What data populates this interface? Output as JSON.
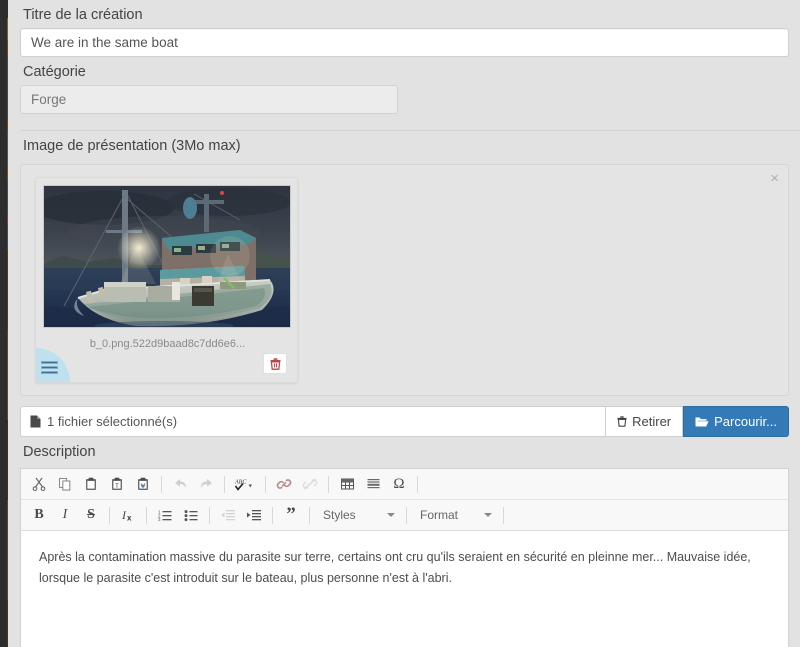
{
  "form": {
    "title_label": "Titre de la création",
    "title_value": "We are in the same boat",
    "category_label": "Catégorie",
    "category_value": "Forge",
    "image_label": "Image de présentation (3Mo max)",
    "description_label": "Description"
  },
  "dropzone": {
    "close_icon": "×",
    "thumbnail": {
      "filename": "b_0.png.522d9baad8c7dd6e6...",
      "alt": "fishing-trawler-at-night",
      "trash_icon": "trash-icon",
      "handle_icon": "drag-handle-icon"
    }
  },
  "file_row": {
    "file_icon": "file-icon",
    "status_text": "1 fichier sélectionné(s)",
    "remove_label": "Retirer",
    "remove_icon": "trash-icon",
    "browse_label": "Parcourir...",
    "browse_icon": "folder-open-icon"
  },
  "editor": {
    "toolbar_row1": [
      {
        "name": "cut-icon",
        "title": "Couper",
        "disabled": false
      },
      {
        "name": "copy-icon",
        "title": "Copier",
        "disabled": false
      },
      {
        "name": "paste-icon",
        "title": "Coller",
        "disabled": false
      },
      {
        "name": "paste-text-icon",
        "title": "Coller comme texte",
        "disabled": false
      },
      {
        "name": "paste-word-icon",
        "title": "Coller depuis Word",
        "disabled": false
      },
      {
        "name": "undo-icon",
        "title": "Annuler",
        "disabled": true
      },
      {
        "name": "redo-icon",
        "title": "Rétablir",
        "disabled": true
      },
      {
        "name": "spellcheck-icon",
        "title": "Vérification orthographique",
        "disabled": false
      },
      {
        "name": "link-icon",
        "title": "Lien",
        "disabled": false
      },
      {
        "name": "unlink-icon",
        "title": "Supprimer le lien",
        "disabled": true
      },
      {
        "name": "table-icon",
        "title": "Tableau",
        "disabled": false
      },
      {
        "name": "horizontal-rule-icon",
        "title": "Ligne horizontale",
        "disabled": false
      },
      {
        "name": "special-char-icon",
        "title": "Caractère spécial",
        "disabled": false,
        "glyph": "Ω"
      }
    ],
    "toolbar_row2": [
      {
        "name": "bold-icon",
        "title": "Gras",
        "glyph": "B",
        "disabled": false
      },
      {
        "name": "italic-icon",
        "title": "Italique",
        "glyph": "I",
        "disabled": false
      },
      {
        "name": "strikethrough-icon",
        "title": "Barré",
        "glyph": "S",
        "disabled": false
      },
      {
        "name": "remove-format-icon",
        "title": "Supprimer la mise en forme",
        "disabled": false
      },
      {
        "name": "numbered-list-icon",
        "title": "Liste numérotée",
        "disabled": false
      },
      {
        "name": "bulleted-list-icon",
        "title": "Liste à puces",
        "disabled": false
      },
      {
        "name": "outdent-icon",
        "title": "Diminuer le retrait",
        "disabled": true
      },
      {
        "name": "indent-icon",
        "title": "Augmenter le retrait",
        "disabled": false
      },
      {
        "name": "blockquote-icon",
        "title": "Citation",
        "glyph": "”",
        "disabled": false
      }
    ],
    "styles_dropdown": "Styles",
    "format_dropdown": "Format",
    "content": "Après la contamination massive du parasite sur terre, certains ont cru qu'ils seraient en sécurité en pleinne mer... Mauvaise idée, lorsque le parasite c'est introduit sur le bateau, plus personne n'est à l'abri."
  },
  "colors": {
    "panel_bg": "#e2e2e2",
    "primary": "#337ab7",
    "danger": "#b94a48",
    "handle": "#bfe0ef",
    "text": "#444444"
  }
}
